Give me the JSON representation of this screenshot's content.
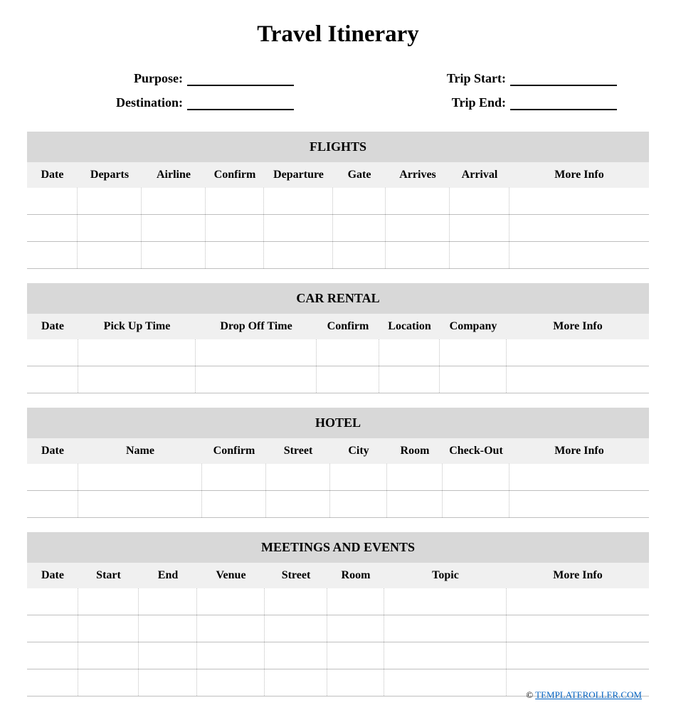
{
  "title": "Travel Itinerary",
  "header": {
    "purpose_label": "Purpose:",
    "destination_label": "Destination:",
    "trip_start_label": "Trip Start:",
    "trip_end_label": "Trip End:",
    "purpose": "",
    "destination": "",
    "trip_start": "",
    "trip_end": ""
  },
  "sections": {
    "flights": {
      "title": "FLIGHTS",
      "columns": [
        "Date",
        "Departs",
        "Airline",
        "Confirm",
        "Departure",
        "Gate",
        "Arrives",
        "Arrival",
        "More Info"
      ],
      "row_count": 3
    },
    "car_rental": {
      "title": "CAR RENTAL",
      "columns": [
        "Date",
        "Pick Up Time",
        "Drop Off Time",
        "Confirm",
        "Location",
        "Company",
        "More Info"
      ],
      "row_count": 2
    },
    "hotel": {
      "title": "HOTEL",
      "columns": [
        "Date",
        "Name",
        "Confirm",
        "Street",
        "City",
        "Room",
        "Check-Out",
        "More Info"
      ],
      "row_count": 2
    },
    "meetings": {
      "title": "MEETINGS AND EVENTS",
      "columns": [
        "Date",
        "Start",
        "End",
        "Venue",
        "Street",
        "Room",
        "Topic",
        "More Info"
      ],
      "row_count": 4
    }
  },
  "footer": {
    "copyright": "©",
    "link_text": "TEMPLATEROLLER.COM"
  }
}
